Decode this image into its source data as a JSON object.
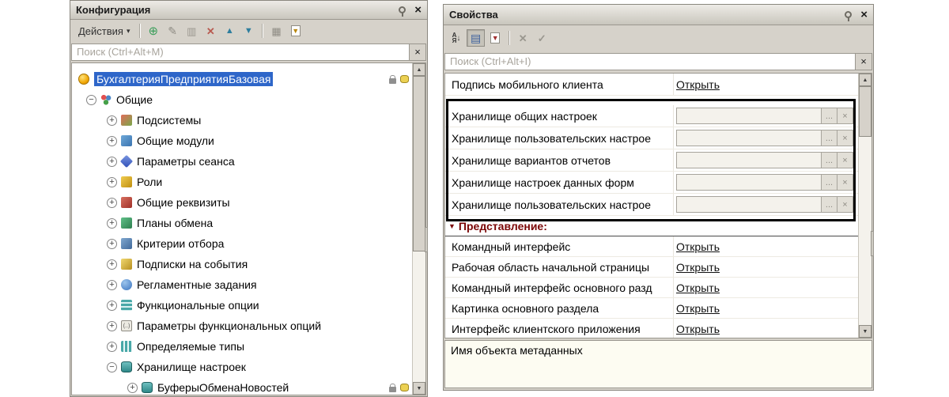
{
  "colors": {
    "selection_blue": "#2e66c9",
    "section_header_maroon": "#7a0505",
    "chrome_gray": "#d6d2ca",
    "highlight_border": "#000000"
  },
  "left_panel": {
    "title": "Конфигурация",
    "toolbar": {
      "actions_label": "Действия",
      "icons": [
        "add-icon",
        "edit-icon",
        "copy-icon",
        "delete-icon",
        "move-up-icon",
        "move-down-icon",
        "grid-icon",
        "filter-by-subsystems-icon"
      ]
    },
    "search": {
      "placeholder": "Поиск (Ctrl+Alt+M)"
    },
    "tree": {
      "root": {
        "label": "БухгалтерияПредприятияБазовая",
        "icon": "configuration-root-icon"
      },
      "group": {
        "label": "Общие",
        "icon": "common-group-icon"
      },
      "items": [
        {
          "label": "Подсистемы",
          "icon": "subsystems-icon"
        },
        {
          "label": "Общие модули",
          "icon": "common-modules-icon"
        },
        {
          "label": "Параметры сеанса",
          "icon": "session-parameters-icon"
        },
        {
          "label": "Роли",
          "icon": "roles-icon"
        },
        {
          "label": "Общие реквизиты",
          "icon": "common-attributes-icon"
        },
        {
          "label": "Планы обмена",
          "icon": "exchange-plans-icon"
        },
        {
          "label": "Критерии отбора",
          "icon": "filter-criteria-icon"
        },
        {
          "label": "Подписки на события",
          "icon": "event-subscriptions-icon"
        },
        {
          "label": "Регламентные задания",
          "icon": "scheduled-jobs-icon"
        },
        {
          "label": "Функциональные опции",
          "icon": "functional-options-icon"
        },
        {
          "label": "Параметры функциональных опций",
          "icon": "functional-option-parameters-icon"
        },
        {
          "label": "Определяемые типы",
          "icon": "defined-types-icon"
        }
      ],
      "storage_group": {
        "label": "Хранилище настроек",
        "icon": "settings-storage-icon"
      },
      "storage_child": {
        "label": "БуферыОбменаНовостей",
        "icon": "settings-storage-icon"
      }
    }
  },
  "right_panel": {
    "title": "Свойства",
    "toolbar": {
      "icons": [
        "sort-alphabetical-icon",
        "categories-view-icon",
        "filter-properties-icon",
        "discard-icon",
        "apply-icon"
      ]
    },
    "search": {
      "placeholder": "Поиск (Ctrl+Alt+I)"
    },
    "top_row": {
      "label": "Подпись мобильного клиента",
      "action": "Открыть"
    },
    "storage_rows": [
      {
        "label": "Хранилище общих настроек"
      },
      {
        "label": "Хранилище пользовательских настрое"
      },
      {
        "label": "Хранилище вариантов отчетов"
      },
      {
        "label": "Хранилище настроек данных форм"
      },
      {
        "label": "Хранилище пользовательских настрое"
      }
    ],
    "field_buttons": {
      "ellipsis": "...",
      "clear": "×"
    },
    "section_header": "Представление:",
    "link_rows": [
      {
        "label": "Командный интерфейс",
        "action": "Открыть"
      },
      {
        "label": "Рабочая область начальной страницы",
        "action": "Открыть"
      },
      {
        "label": "Командный интерфейс основного разд",
        "action": "Открыть"
      },
      {
        "label": "Картинка основного раздела",
        "action": "Открыть"
      },
      {
        "label": "Интерфейс клиентского приложения",
        "action": "Открыть"
      }
    ],
    "description": "Имя объекта метаданных"
  }
}
